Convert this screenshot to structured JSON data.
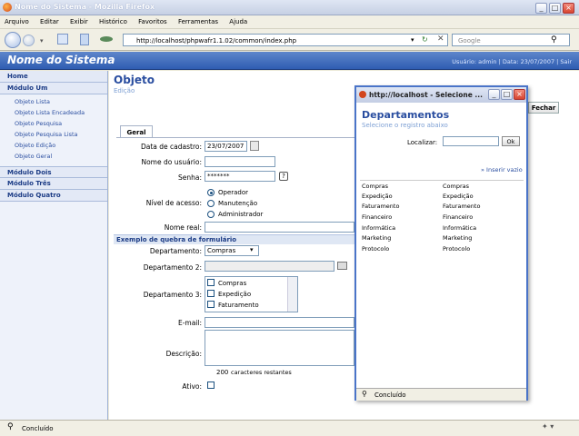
{
  "window": {
    "title": "Nome do Sistema - Mozilla Firefox"
  },
  "menu": [
    "Arquivo",
    "Editar",
    "Exibir",
    "Histórico",
    "Favoritos",
    "Ferramentas",
    "Ajuda"
  ],
  "nav": {
    "url": "http://localhost/phpwafr1.1.02/common/index.php",
    "search_placeholder": "Google"
  },
  "app": {
    "name": "Nome do Sistema",
    "user_info": "Usuário: admin | Data: 23/07/2007 | Sair"
  },
  "sidebar": {
    "home": "Home",
    "modulo_um": "Módulo Um",
    "sub": [
      "Objeto Lista",
      "Objeto Lista Encadeada",
      "Objeto Pesquisa",
      "Objeto Pesquisa Lista",
      "Objeto Edição",
      "Objeto Geral"
    ],
    "others": [
      "Módulo Dois",
      "Módulo Três",
      "Módulo Quatro"
    ]
  },
  "page": {
    "title": "Objeto",
    "subtitle": "Edição",
    "close_label": "Fechar",
    "tab": "Geral"
  },
  "form": {
    "data_label": "Data de cadastro:",
    "data_value": "23/07/2007",
    "usuario_label": "Nome do usuário:",
    "senha_label": "Senha:",
    "senha_value": "*******",
    "nivel_label": "Nível de acesso:",
    "nivel_options": [
      "Operador",
      "Manutenção",
      "Administrador"
    ],
    "nome_label": "Nome real:",
    "section": "Exemplo de quebra de formulário",
    "dep_label": "Departamento:",
    "dep_value": "Compras",
    "dep2_label": "Departamento 2:",
    "dep3_label": "Departamento 3:",
    "dep3_options": [
      "Compras",
      "Expedição",
      "Faturamento"
    ],
    "email_label": "E-mail:",
    "desc_label": "Descrição:",
    "desc_counter": "200",
    "desc_counter_text": "caracteres restantes",
    "ativo_label": "Ativo:"
  },
  "popup": {
    "title": "http://localhost - Selecione ...",
    "heading": "Departamentos",
    "subheading": "Selecione o registro abaixo",
    "search_label": "Localizar:",
    "ok_label": "Ok",
    "insert_link": "» Inserir vazio",
    "rows": [
      [
        "Compras",
        "Compras"
      ],
      [
        "Expedição",
        "Expedição"
      ],
      [
        "Faturamento",
        "Faturamento"
      ],
      [
        "Financeiro",
        "Financeiro"
      ],
      [
        "Informática",
        "Informática"
      ],
      [
        "Marketing",
        "Marketing"
      ],
      [
        "Protocolo",
        "Protocolo"
      ]
    ],
    "status": "Concluído"
  },
  "status": {
    "text": "Concluído"
  }
}
